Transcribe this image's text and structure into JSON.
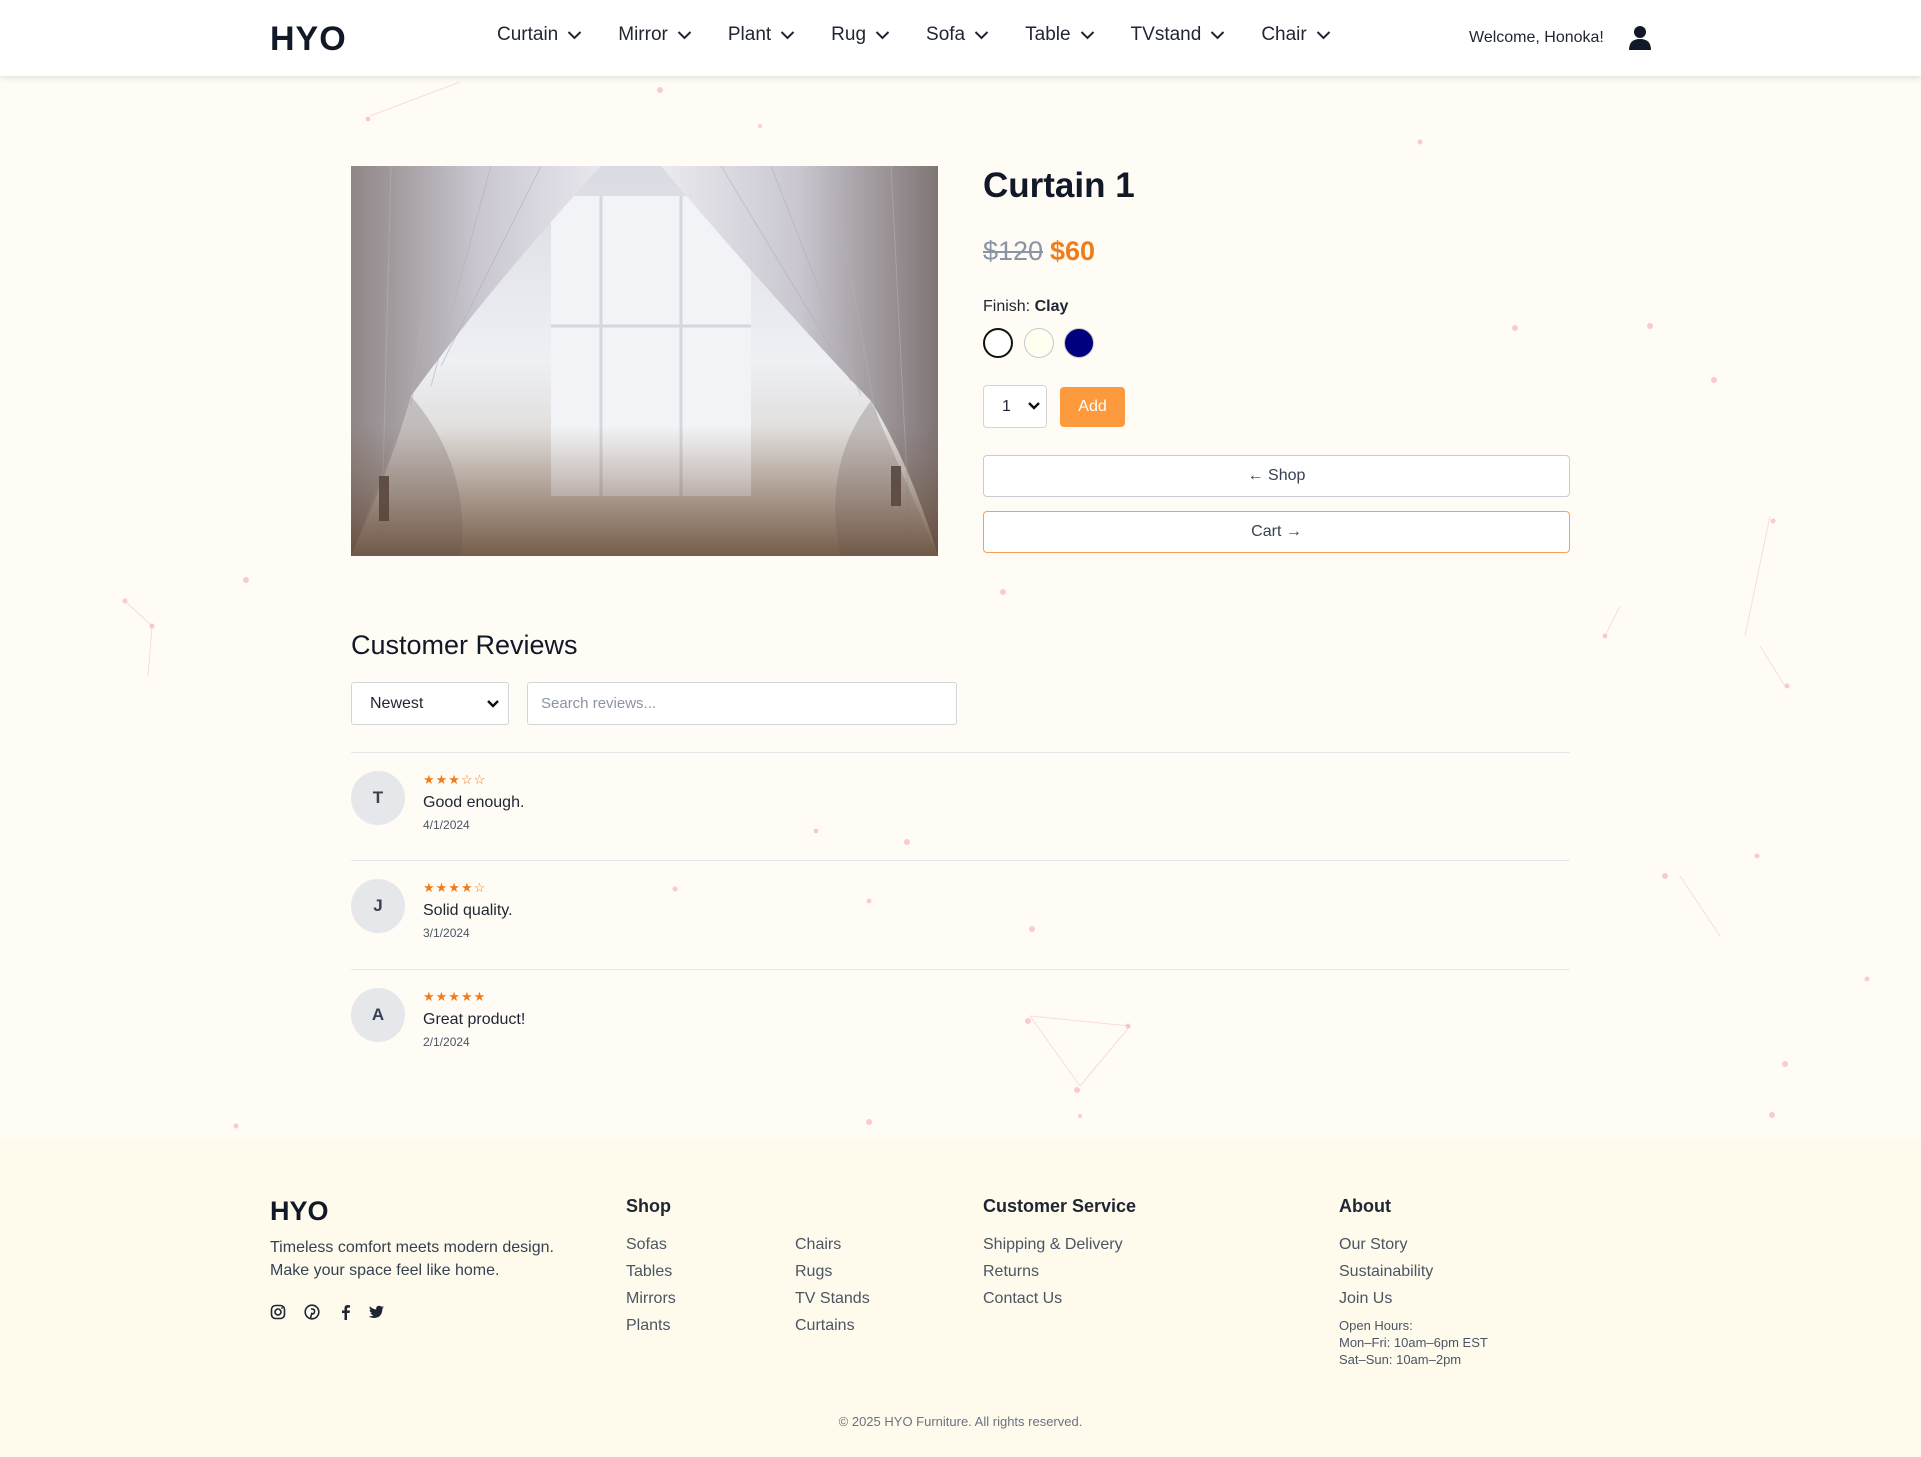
{
  "header": {
    "logo": "HYO",
    "nav": [
      "Curtain",
      "Mirror",
      "Plant",
      "Rug",
      "Sofa",
      "Table",
      "TVstand",
      "Chair"
    ],
    "welcome": "Welcome, Honoka!"
  },
  "product": {
    "title": "Curtain 1",
    "price_old": "$120",
    "price_new": "$60",
    "finish_label": "Finish:",
    "finish_value": "Clay",
    "swatches": [
      "#ffffff",
      "#fffff0",
      "#00007f"
    ],
    "quantity": "1",
    "add_label": "Add",
    "shop_label": "← Shop",
    "cart_label": "Cart →"
  },
  "reviews": {
    "title": "Customer Reviews",
    "sort": "Newest",
    "search_placeholder": "Search reviews...",
    "items": [
      {
        "initial": "T",
        "stars": "★★★☆☆",
        "rating": 3,
        "text": "Good enough.",
        "date": "4/1/2024"
      },
      {
        "initial": "J",
        "stars": "★★★★☆",
        "rating": 4,
        "text": "Solid quality.",
        "date": "3/1/2024"
      },
      {
        "initial": "A",
        "stars": "★★★★★",
        "rating": 5,
        "text": "Great product!",
        "date": "2/1/2024"
      }
    ]
  },
  "footer": {
    "logo": "HYO",
    "tagline_1": "Timeless comfort meets modern design.",
    "tagline_2": "Make your space feel like home.",
    "shop_title": "Shop",
    "shop_links_a": [
      "Sofas",
      "Tables",
      "Mirrors",
      "Plants"
    ],
    "shop_links_b": [
      "Chairs",
      "Rugs",
      "TV Stands",
      "Curtains"
    ],
    "service_title": "Customer Service",
    "service_links": [
      "Shipping & Delivery",
      "Returns",
      "Contact Us"
    ],
    "about_title": "About",
    "about_links": [
      "Our Story",
      "Sustainability",
      "Join Us"
    ],
    "hours": [
      "Open Hours:",
      "Mon–Fri: 10am–6pm EST",
      "Sat–Sun: 10am–2pm"
    ],
    "copyright": "© 2025 HYO Furniture. All rights reserved."
  },
  "colors": {
    "accent": "#fd9a3d",
    "sale": "#f07d1a",
    "background": "#fffcf6",
    "footer_bg": "#fefbed"
  },
  "icons": [
    "chevron-down-icon",
    "user-icon",
    "instagram-icon",
    "pinterest-icon",
    "facebook-icon",
    "twitter-icon"
  ]
}
